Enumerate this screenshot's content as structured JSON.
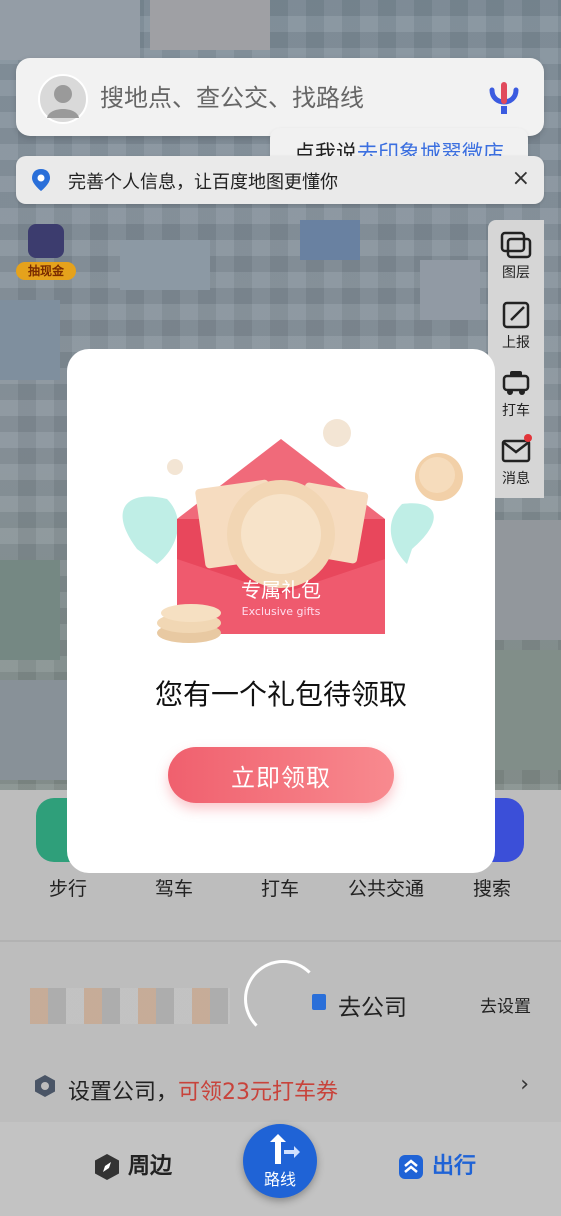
{
  "search": {
    "placeholder": "搜地点、查公交、找路线"
  },
  "voice_bubble": {
    "prefix": "点我说",
    "highlight": "去印象城翠微店"
  },
  "notice": {
    "text": "完善个人信息，让百度地图更懂你",
    "close": "×"
  },
  "cash_badge": {
    "label": "抽现金"
  },
  "map_tools": [
    {
      "label": "图层",
      "icon": "layers-icon"
    },
    {
      "label": "上报",
      "icon": "report-edit-icon"
    },
    {
      "label": "打车",
      "icon": "taxi-icon"
    },
    {
      "label": "消息",
      "icon": "message-icon",
      "has_dot": true
    }
  ],
  "modal": {
    "envelope_title": "专属礼包",
    "envelope_subtitle": "Exclusive gifts",
    "title": "您有一个礼包待领取",
    "button": "立即领取"
  },
  "quick_actions": [
    {
      "label": "步行",
      "color": "#2f9f7a"
    },
    {
      "label": "驾车",
      "color": "#e79b2a"
    },
    {
      "label": "打车",
      "color": "#f0a51c"
    },
    {
      "label": "公共交通",
      "color": "#2a6fd9"
    },
    {
      "label": "搜索",
      "color": "#3b4fd8"
    }
  ],
  "commute": {
    "label": "去公司",
    "setup": "去设置"
  },
  "company": {
    "text": "设置公司，",
    "highlight": "可领23元打车券",
    "arrow": "›"
  },
  "tabbar": {
    "nearby": "周边",
    "route": "路线",
    "travel": "出行"
  },
  "colors": {
    "accent": "#2f6fe0",
    "claim_button": "#f0606e",
    "promo": "#c8433b"
  }
}
